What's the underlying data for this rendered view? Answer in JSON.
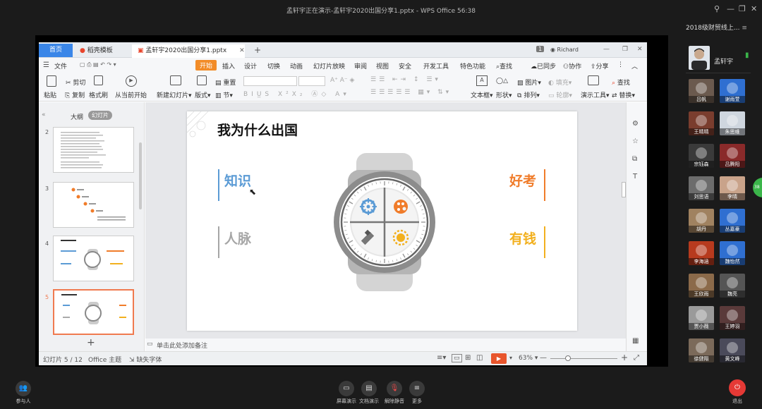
{
  "window": {
    "title": "孟轩宇正在演示-孟轩宇2020出国分享1.pptx - WPS Office 56:38",
    "group_name": "2018级财贸线上..."
  },
  "wps": {
    "tabs": {
      "home": "首页",
      "template": "稻壳模板",
      "doc": "孟轩宇2020出国分享1.pptx"
    },
    "user": "Richard",
    "menus": [
      "文件",
      "开始",
      "插入",
      "设计",
      "切换",
      "动画",
      "幻灯片放映",
      "审阅",
      "视图",
      "安全",
      "开发工具",
      "特色功能",
      "查找"
    ],
    "menu_right": [
      "已同步",
      "协作",
      "分享"
    ],
    "ribbon": {
      "paste": "粘贴",
      "cut": "剪切",
      "copy": "复制",
      "format_painter": "格式刷",
      "from_current": "从当前开始",
      "new_slide": "新建幻灯片",
      "layout": "版式",
      "section": "节",
      "reset": "重置",
      "textbox": "文本框",
      "shape": "形状",
      "arrange": "排列",
      "picture": "图片",
      "fill": "填充",
      "outline": "轮廓",
      "present_tools": "演示工具",
      "find": "查找",
      "replace": "替换"
    },
    "pane_tabs": {
      "outline": "大纲",
      "slides": "幻灯片"
    },
    "thumb_numbers": [
      "2",
      "3",
      "4",
      "5"
    ],
    "notes_placeholder": "单击此处添加备注",
    "status": {
      "slide": "幻灯片 5 / 12",
      "theme": "Office 主题",
      "font": "缺失字体",
      "zoom": "63%"
    }
  },
  "slide": {
    "title": "我为什么出国",
    "left_top": "知识",
    "left_bottom": "人脉",
    "right_top": "好考",
    "right_bottom": "有钱",
    "colors": {
      "blue": "#5b9bd5",
      "gray": "#a6a6a6",
      "orange": "#f07c2a",
      "gold": "#f2b01e"
    }
  },
  "participants": {
    "presenter": "孟轩宇",
    "members": [
      "吕帆",
      "谢雨萱",
      "王晴晴",
      "朱思维",
      "宗钰森",
      "吕腾阳",
      "刘思语",
      "李晴",
      "胡丹",
      "丛嘉豪",
      "李海涵",
      "魏怡然",
      "王欣雨",
      "魏亮",
      "贾小薇",
      "王婷羽",
      "徐健翔",
      "黄文峰"
    ]
  },
  "bottom": {
    "participants_label": "参与人",
    "screen_share": "屏幕演示",
    "doc_share": "文档演示",
    "unmute": "解除静音",
    "more": "更多",
    "leave": "退出"
  }
}
